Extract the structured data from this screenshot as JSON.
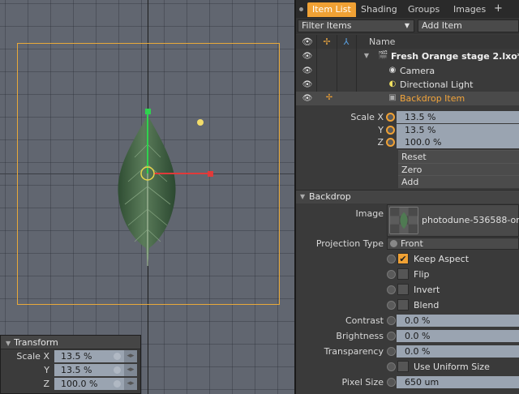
{
  "viewport": {
    "transform": {
      "title": "Transform",
      "rows": [
        {
          "label": "Scale X",
          "value": "13.5 %"
        },
        {
          "label": "Y",
          "value": "13.5 %"
        },
        {
          "label": "Z",
          "value": "100.0 %"
        }
      ]
    }
  },
  "panel": {
    "tabs": [
      "Item List",
      "Shading",
      "Groups",
      "Images",
      "+"
    ],
    "filter": "Filter Items",
    "add_item": "Add Item",
    "list_header": {
      "name": "Name"
    },
    "items": [
      {
        "name": "Fresh Orange stage 2.lxo*",
        "type": "scene"
      },
      {
        "name": "Camera",
        "type": "camera"
      },
      {
        "name": "Directional Light",
        "type": "light"
      },
      {
        "name": "Backdrop Item",
        "type": "backdrop"
      }
    ],
    "scale": [
      {
        "label": "Scale X",
        "value": "13.5 %"
      },
      {
        "label": "Y",
        "value": "13.5 %"
      },
      {
        "label": "Z",
        "value": "100.0 %"
      }
    ],
    "scale_buttons": [
      "Reset",
      "Zero",
      "Add"
    ],
    "backdrop_section": "Backdrop",
    "image_label": "Image",
    "image_name": "photodune-536588-or ...",
    "projection_label": "Projection Type",
    "projection_value": "Front",
    "checks": [
      {
        "label": "Keep Aspect",
        "checked": true
      },
      {
        "label": "Flip",
        "checked": false
      },
      {
        "label": "Invert",
        "checked": false
      },
      {
        "label": "Blend",
        "checked": false
      }
    ],
    "sliders": [
      {
        "label": "Contrast",
        "value": "0.0 %"
      },
      {
        "label": "Brightness",
        "value": "0.0 %"
      },
      {
        "label": "Transparency",
        "value": "0.0 %"
      }
    ],
    "uniform_size": "Use Uniform Size",
    "pixel_size": {
      "label": "Pixel Size",
      "value": "650 um"
    }
  }
}
